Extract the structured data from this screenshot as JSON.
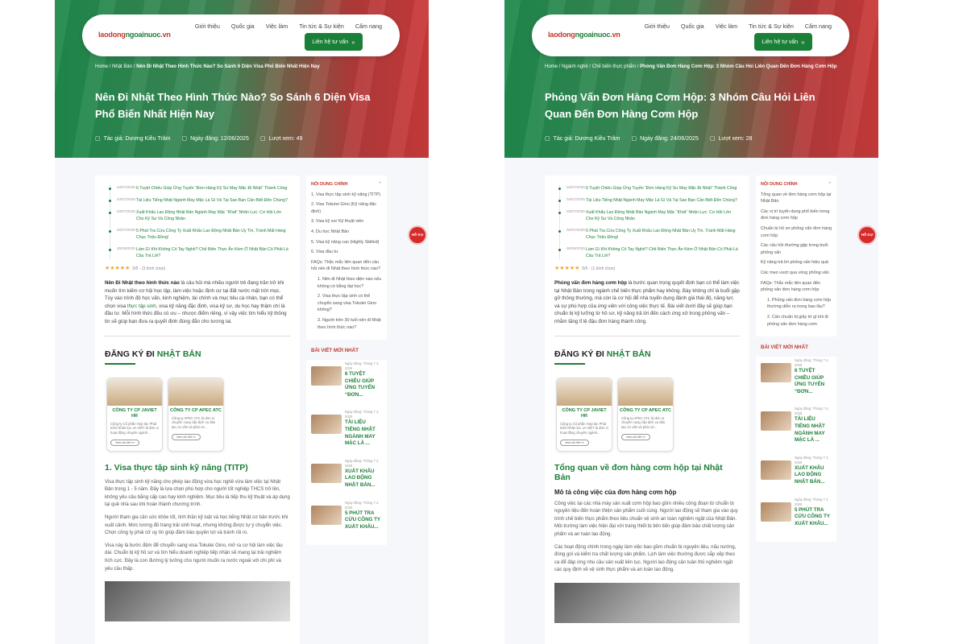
{
  "site": {
    "logo_a": "laodong",
    "logo_b": "ngoainuoc",
    "logo_c": ".vn",
    "menu": [
      "Giới thiệu",
      "Quốc gia",
      "Việc làm",
      "Tin tức & Sự kiện",
      "Cẩm nang"
    ],
    "cta": "Liên hệ tư vấn",
    "cta_icon": "»",
    "help": "Hỗ trợ"
  },
  "left": {
    "crumbs": [
      "Home",
      "Nhật Bản",
      "Nên Đi Nhật Theo Hình Thức Nào? So Sánh 6 Diện Visa Phổ Biến Nhất Hiện Nay"
    ],
    "title": "Nên Đi Nhật Theo Hình Thức Nào? So Sánh 6 Diện Visa Phổ Biến Nhất Hiện Nay",
    "author": "Tác giả: Dương Kiều Trâm",
    "date": "Ngày đăng: 12/06/2025",
    "views": "Lượt xem: 49",
    "related": [
      {
        "d": "04/07/2025",
        "t": "6 Tuyệt Chiêu Giúp Ứng Tuyển “Đơn Hàng Kỹ Sư May Mặc Đi Nhật” Thành Công"
      },
      {
        "d": "04/07/2025",
        "t": "Tài Liệu Tiếng Nhật Ngành May Mặc Là Gì Và Tại Sao Bạn Cần Biết Đến Chúng?"
      },
      {
        "d": "03/07/2025",
        "t": "Xuất Khẩu Lao Động Nhật Bản Ngành May Mặc “Khát” Nhân Lực: Cơ Hội Lớn Cho Kỹ Sư Và Công Nhân"
      },
      {
        "d": "02/07/2025",
        "t": "5 Phút Tra Cứu Công Ty Xuất Khẩu Lao Động Nhật Bản Uy Tín, Tránh Mất Hàng Chục Triệu Đồng!"
      },
      {
        "d": "30/06/2025",
        "t": "Làm Gì Khi Không Có Tay Nghề? Chế Biến Thực Ăn Kèm Ở Nhật Bản Có Phải Là Câu Trả Lời?"
      }
    ],
    "rating": "5/5 - (3 bình chọn)",
    "intro_bold": "Nên Đi Nhật theo hình thức nào",
    "intro_1": " là câu hỏi mà nhiều người trẻ đang trăn trở khi muốn tìm kiếm cơ hội học tập, làm việc hoặc định cư tại đất nước mặt trời mọc. Tùy vào trình độ học vấn, kinh nghiệm, tài chính và mục tiêu cá nhân, bạn có thể chọn visa ",
    "intro_link": "thực tập sinh",
    "intro_2": ", visa kỹ năng đặc định, visa kỹ sư, du học hay thậm chí là đầu tư. Mỗi hình thức đều có ưu – nhược điểm riêng, vì vậy việc tìm hiểu kỹ thông tin sẽ giúp bạn đưa ra quyết định đúng đắn cho tương lai.",
    "reg_a": "ĐĂNG KÝ ĐI",
    "reg_b": "NHẬT BẢN",
    "cards": [
      {
        "n": "CÔNG TY CP JAVIET HR",
        "d": "Công ty Cổ phần Hợp tác Phát triển Nhân lực JA VIỆT là đơn vị hoạt động chuyên ngành...",
        "b": "Xem chi tiết »»"
      },
      {
        "n": "CÔNG TY CP APEC ATC",
        "d": "Công ty APEC ATC là đơn vị chuyên cung cấp dịch vụ đào tạo, tư vấn và phái cử...",
        "b": "Xem chi tiết »»"
      }
    ],
    "h2": "1. Visa thực tập sinh kỹ năng (TITP)",
    "p1": "Visa thực tập sinh kỹ năng cho phép lao động vừa học nghề vừa làm việc tại Nhật Bản trong 1 - 5 năm. Đây là lựa chọn phù hợp cho người tốt nghiệp THCS trở lên, không yêu cầu bằng cấp cao hay kinh nghiệm. Mục tiêu là tiếp thu kỹ thuật và áp dụng tại quê nhà sau khi hoàn thành chương trình.",
    "p2": "Người tham gia cần sức khỏe tốt, tinh thần kỷ luật và học tiếng Nhật cơ bản trước khi xuất cảnh. Mức lương đủ trang trải sinh hoạt, nhưng không được tự ý chuyển việc. Chọn công ty phái cử uy tín giúp đảm bảo quyền lợi và tránh rủi ro.",
    "p3": "Visa này là bước đệm để chuyển sang visa Tokutei Gino, mở ra cơ hội làm việc lâu dài. Chuẩn bị kỹ hồ sơ và tìm hiểu doanh nghiệp tiếp nhận sẽ mang lại trải nghiệm tích cực. Đây là con đường lý tưởng cho người muốn ra nước ngoài với chi phí và yêu cầu thấp.",
    "toc_title": "NỘI DUNG CHÍNH",
    "toc": [
      "1. Visa thực tập sinh kỹ năng (TITP)",
      "2. Visa Tokutei Gino (Kỹ năng đặc định)",
      "3. Visa kỹ sư/ Kỹ thuật viên",
      "4. Du học Nhật Bản",
      "5. Visa kỹ năng cao (Highly Skilled)",
      "6. Visa đầu tư",
      "FAQs: Thắc mắc liên quan đến câu hỏi nên đi Nhật theo hình thức nào?"
    ],
    "toc_sub": [
      "1. Nên đi Nhật theo diện nào nếu không có bằng đại học?",
      "2. Visa thực tập sinh có thể chuyển sang visa Tokutei Gino không?",
      "3. Người trên 30 tuổi nên đi Nhật theo hình thức nào?"
    ]
  },
  "right": {
    "crumbs": [
      "Home",
      "Ngành nghề",
      "Chế biến thực phẩm",
      "Phỏng Vấn Đơn Hàng Cơm Hộp: 3 Nhóm Câu Hỏi Liên Quan Đến Đơn Hàng Cơm Hộp"
    ],
    "title": "Phỏng Vấn Đơn Hàng Cơm Hộp: 3 Nhóm Câu Hỏi Liên Quan Đến Đơn Hàng Cơm Hộp",
    "author": "Tác giả: Dương Kiều Trâm",
    "date": "Ngày đăng: 24/06/2025",
    "views": "Lượt xem: 28",
    "rating": "5/5 - (1 bình chọn)",
    "intro_bold": "Phỏng vấn đơn hàng cơm hộp",
    "intro": " là bước quan trọng quyết định bạn có thể làm việc tại Nhật Bản trong ngành chế biến thực phẩm hay không. Bày không chỉ là buổi gặp gỡ thông thường, mà còn là cơ hội để nhà tuyển dụng đánh giá thái độ, năng lực và sự phù hợp của ứng viên với công việc thực tế. Bài viết dưới đây sẽ giúp bạn chuẩn bị kỹ lưỡng từ hồ sơ, kỹ năng trả lời đến cách ứng xử trong phỏng vấn – nhằm tăng tỉ lệ đậu đơn hàng thành công.",
    "h2": "Tổng quan về đơn hàng cơm hộp tại Nhật Bản",
    "h3": "Mô tả công việc của đơn hàng cơm hộp",
    "p1": "Công việc tại các nhà máy sản xuất cơm hộp bao gồm nhiều công đoạn từ chuẩn bị nguyên liệu đến hoàn thiện sản phẩm cuối cùng. Người lao động sẽ tham gia vào quy trình chế biến thực phẩm theo tiêu chuẩn vệ sinh an toàn nghiêm ngặt của Nhật Bản. Môi trường làm việc hiện đại với trang thiết bị tiên tiến giúp đảm bảo chất lượng sản phẩm và an toàn lao động.",
    "p2": "Các hoạt động chính trong ngày làm việc bao gồm chuẩn bị nguyên liệu, nấu nướng, đóng gói và kiểm tra chất lượng sản phẩm. Lịch làm việc thường được sắp xếp theo ca để đáp ứng nhu cầu sản xuất liên tục. Người lao động cần tuân thủ nghiêm ngặt các quy định về vệ sinh thực phẩm và an toàn lao động.",
    "toc": [
      "Tổng quan về đơn hàng cơm hộp tại Nhật Bản",
      "Các vị trí tuyển dụng phổ biến trong đơn hàng cơm hộp",
      "Chuẩn bị hồ sơ phỏng vấn đơn hàng cơm hộp",
      "Các câu hỏi thường gặp trong buổi phỏng vấn",
      "Kỹ năng trả lời phỏng vấn hiệu quả",
      "Các mẹo vượt qua vòng phỏng vấn",
      "FAQs: Thắc mắc liên quan đến phỏng vấn đơn hàng cơm hộp"
    ],
    "toc_sub": [
      "1. Phỏng vấn đơn hàng cơm hộp thường diễn ra trong bao lâu?",
      "2. Cần chuẩn bị giấy tờ gì khi đi phỏng vấn đơn hàng cơm"
    ]
  },
  "news_title": "BÀI VIẾT MỚI NHẤT",
  "news": [
    {
      "d": "Ngày đăng: Tháng 7 4, 2025",
      "t": "6 TUYỆT CHIÊU GIÚP ỨNG TUYỂN “ĐƠN..."
    },
    {
      "d": "Ngày đăng: Tháng 7 4, 2025",
      "t": "TÀI LIỆU TIẾNG NHẬT NGÀNH MAY MẶC LÀ ..."
    },
    {
      "d": "Ngày đăng: Tháng 7 3, 2025",
      "t": "XUẤT KHẨU LAO ĐỘNG NHẬT BẢN..."
    },
    {
      "d": "Ngày đăng: Tháng 7 2, 2025",
      "t": "5 PHÚT TRA CỨU CÔNG TY XUẤT KHẨU..."
    }
  ]
}
